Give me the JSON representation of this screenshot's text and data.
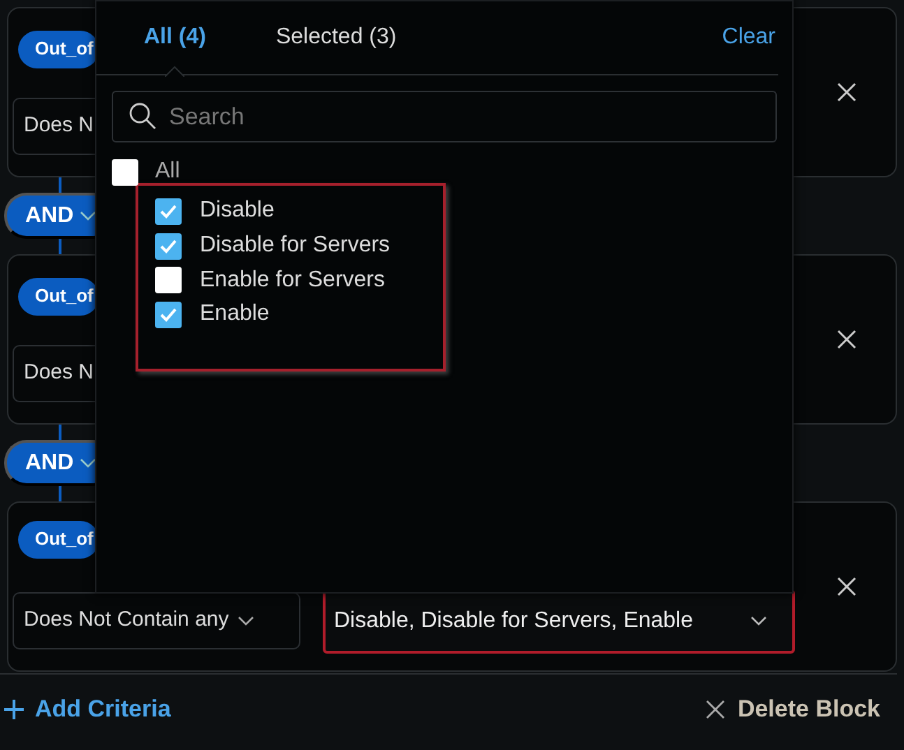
{
  "criteria": [
    {
      "attribute": "Out_of",
      "operator": "Does N"
    },
    {
      "attribute": "Out_of",
      "operator": "Does N"
    },
    {
      "attribute": "Out_of",
      "operator": "Does Not Contain any",
      "value": "Disable, Disable for Servers, Enable",
      "value_highlighted": true
    }
  ],
  "connectors": [
    "AND",
    "AND"
  ],
  "popup": {
    "tabs": [
      {
        "label": "All (4)",
        "selected": true
      },
      {
        "label": "Selected (3)",
        "selected": false
      }
    ],
    "clear": "Clear",
    "search": {
      "placeholder": "Search"
    },
    "all_option": {
      "label": "All",
      "checked": false
    },
    "options_highlighted": true,
    "options": [
      {
        "label": "Disable",
        "checked": true
      },
      {
        "label": "Disable for Servers",
        "checked": true
      },
      {
        "label": "Enable for Servers",
        "checked": false
      },
      {
        "label": "Enable",
        "checked": true
      }
    ]
  },
  "add_criteria": "Add Criteria",
  "delete_block": "Delete Block"
}
